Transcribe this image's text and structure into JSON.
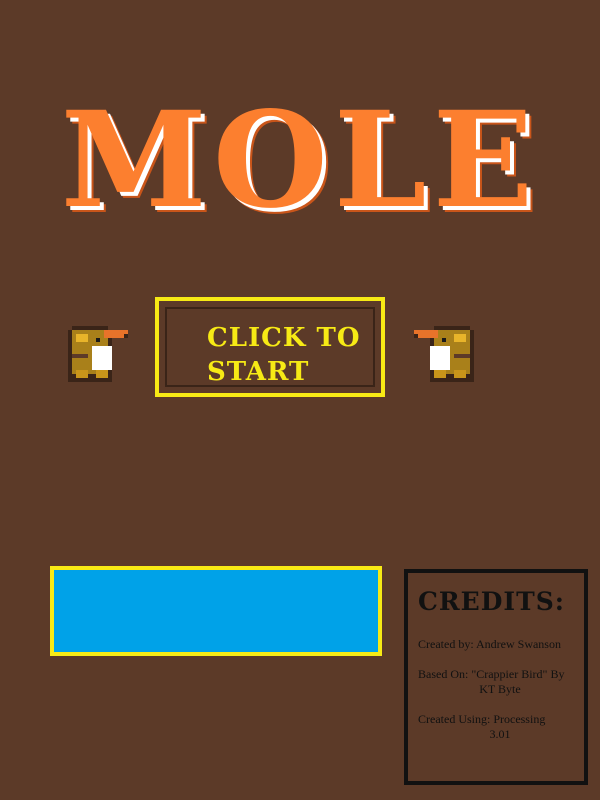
{
  "title": "MOLE",
  "start_button": {
    "line1": "CLICK TO",
    "line2": "START"
  },
  "credits": {
    "heading": "CREDITS:",
    "created_by": "Created by: Andrew Swanson",
    "based_on_1": "Based On: \"Crappier Bird\" By",
    "based_on_2": "KT Byte",
    "created_using_1": "Created Using: Processing",
    "created_using_2": "3.01"
  },
  "colors": {
    "background": "#5c3a28",
    "title": "#fc7f2f",
    "accent_yellow": "#f7ea15",
    "blue_bar": "#00a2e8",
    "mole_body": "#a9801a",
    "mole_belly": "#ffffff",
    "mole_nose": "#e8732a"
  },
  "icons": [
    "mole-sprite"
  ]
}
